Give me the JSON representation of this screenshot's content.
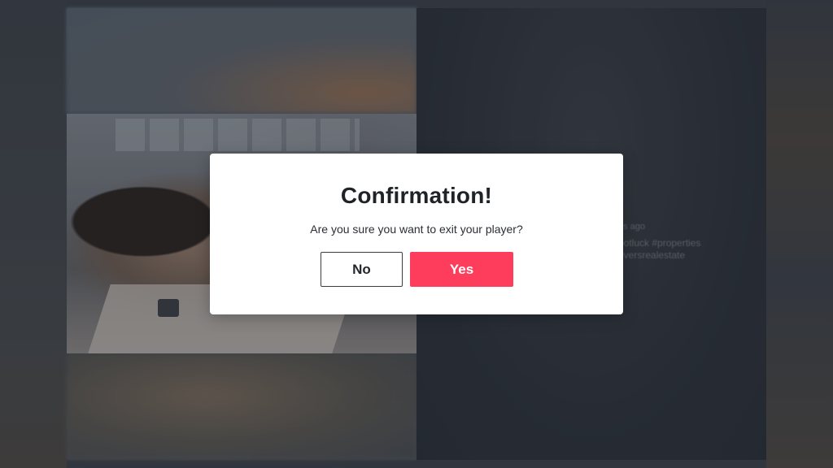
{
  "background": {
    "caption_fragments": [
      "es ago",
      "potluck #properties",
      "oversrealestate"
    ]
  },
  "dialog": {
    "title": "Confirmation!",
    "message": "Are you sure you want to exit your player?",
    "no_label": "No",
    "yes_label": "Yes"
  },
  "colors": {
    "accent": "#fe3c5b",
    "dialog_bg": "#ffffff",
    "backdrop": "#3a3f48"
  }
}
